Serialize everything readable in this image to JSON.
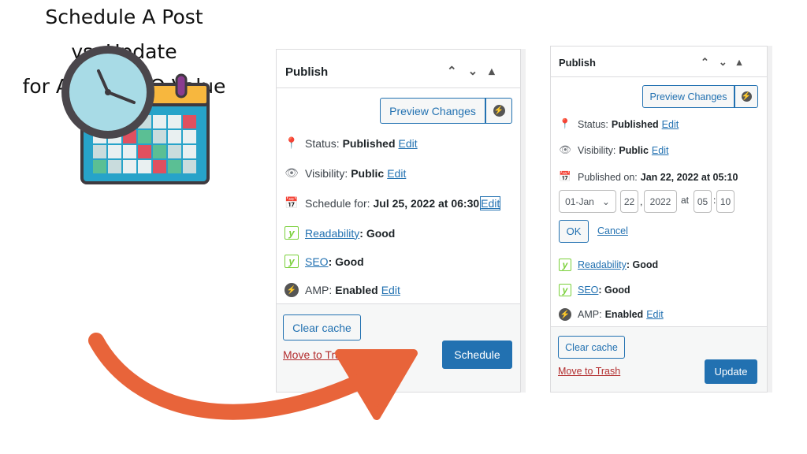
{
  "headline": [
    "Schedule A Post",
    "vs. Update",
    "for Added SEO Value"
  ],
  "icons": {
    "illustration": "clock-calendar-icon",
    "arrow": "curved-arrow",
    "colors": {
      "arrow": "#e8643a",
      "primary": "#2271b1",
      "trash": "#b32d2e",
      "yoast": "#7ad03a"
    }
  },
  "left_panel": {
    "title": "Publish",
    "controls": [
      "^",
      "v",
      "▲"
    ],
    "preview_label": "Preview Changes",
    "status_label": "Status:",
    "status_value": "Published",
    "edit": "Edit",
    "visibility_label": "Visibility:",
    "visibility_value": "Public",
    "schedule_label": "Schedule for:",
    "schedule_value": "Jul 25, 2022 at 06:30",
    "readability_label": "Readability",
    "readability_value": ": Good",
    "seo_label": "SEO",
    "seo_value": ": Good",
    "amp_label": "AMP:",
    "amp_value": "Enabled",
    "clear_cache": "Clear cache",
    "trash": "Move to Trash",
    "primary": "Schedule"
  },
  "right_panel": {
    "title": "Publish",
    "controls": [
      "^",
      "v",
      "▲"
    ],
    "preview_label": "Preview Changes",
    "status_label": "Status:",
    "status_value": "Published",
    "edit": "Edit",
    "visibility_label": "Visibility:",
    "visibility_value": "Public",
    "published_label": "Published on:",
    "published_value": "Jan 22, 2022 at 05:10",
    "month": "01-Jan",
    "day": "22",
    "year": "2022",
    "at": "at",
    "hour": "05",
    "minute": "10",
    "ok": "OK",
    "cancel": "Cancel",
    "readability_label": "Readability",
    "readability_value": ": Good",
    "seo_label": "SEO",
    "seo_value": ": Good",
    "amp_label": "AMP:",
    "amp_value": "Enabled",
    "clear_cache": "Clear cache",
    "trash": "Move to Trash",
    "primary": "Update"
  }
}
